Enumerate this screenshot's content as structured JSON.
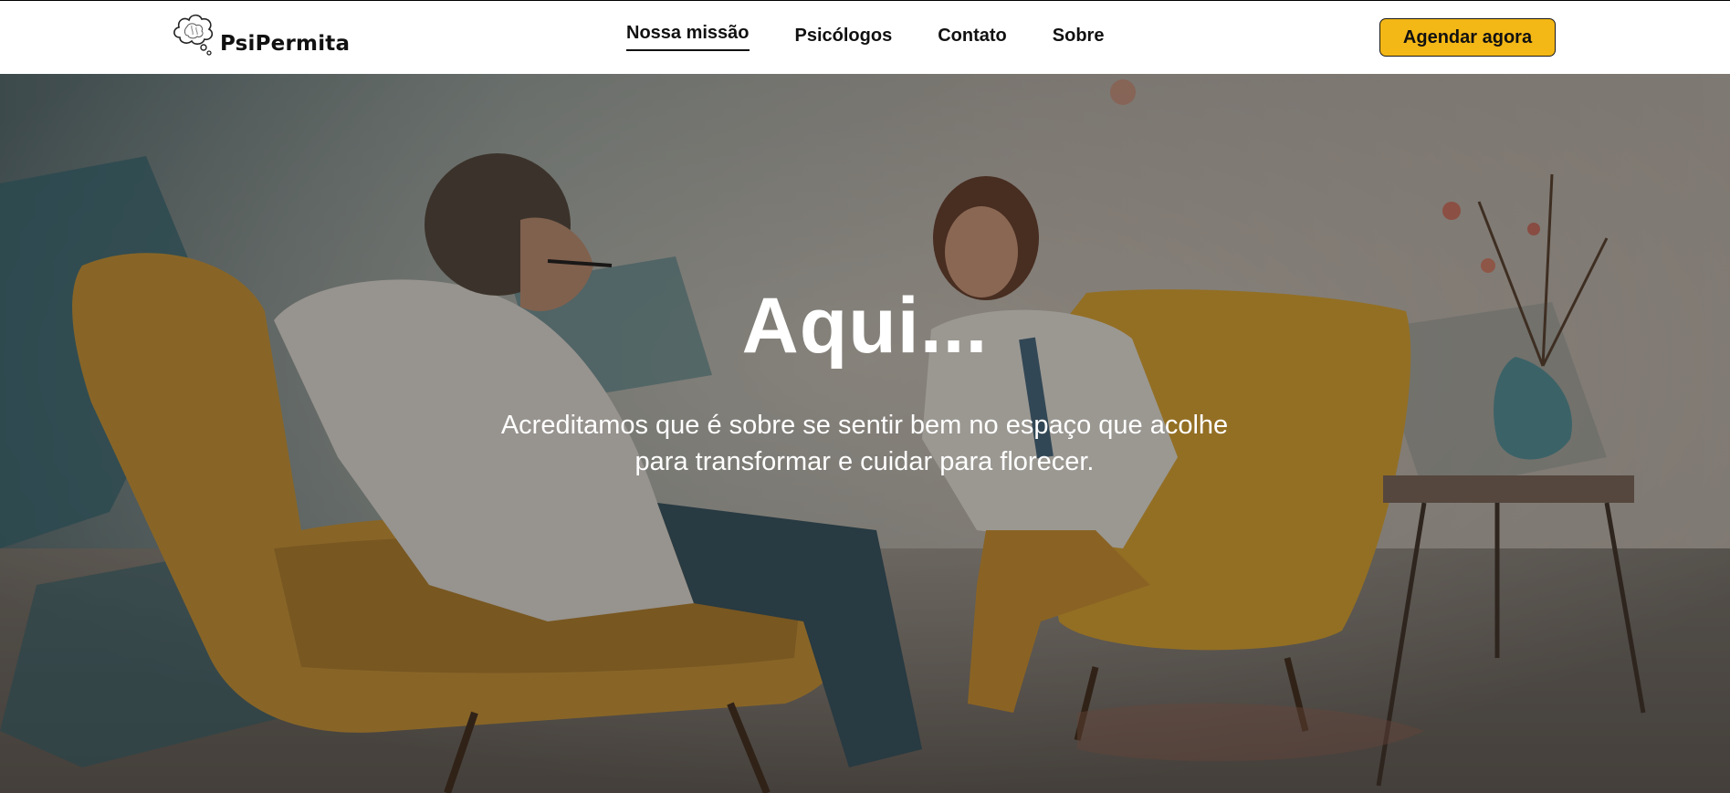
{
  "brand": {
    "name": "PsiPermita",
    "logo_icon": "brain-cloud-icon"
  },
  "nav": {
    "items": [
      {
        "label": "Nossa missão",
        "active": true
      },
      {
        "label": "Psicólogos",
        "active": false
      },
      {
        "label": "Contato",
        "active": false
      },
      {
        "label": "Sobre",
        "active": false
      }
    ],
    "cta_label": "Agendar agora"
  },
  "hero": {
    "title": "Aqui...",
    "subtitle_lines": [
      "Acreditamos que é sobre se sentir bem no espaço que acolhe",
      "para transformar e cuidar para florecer."
    ],
    "image_subject": "therapy-session-painting"
  },
  "colors": {
    "accent": "#f3b716",
    "text_dark": "#111111",
    "hero_text": "#ffffff",
    "header_bg": "#ffffff"
  }
}
